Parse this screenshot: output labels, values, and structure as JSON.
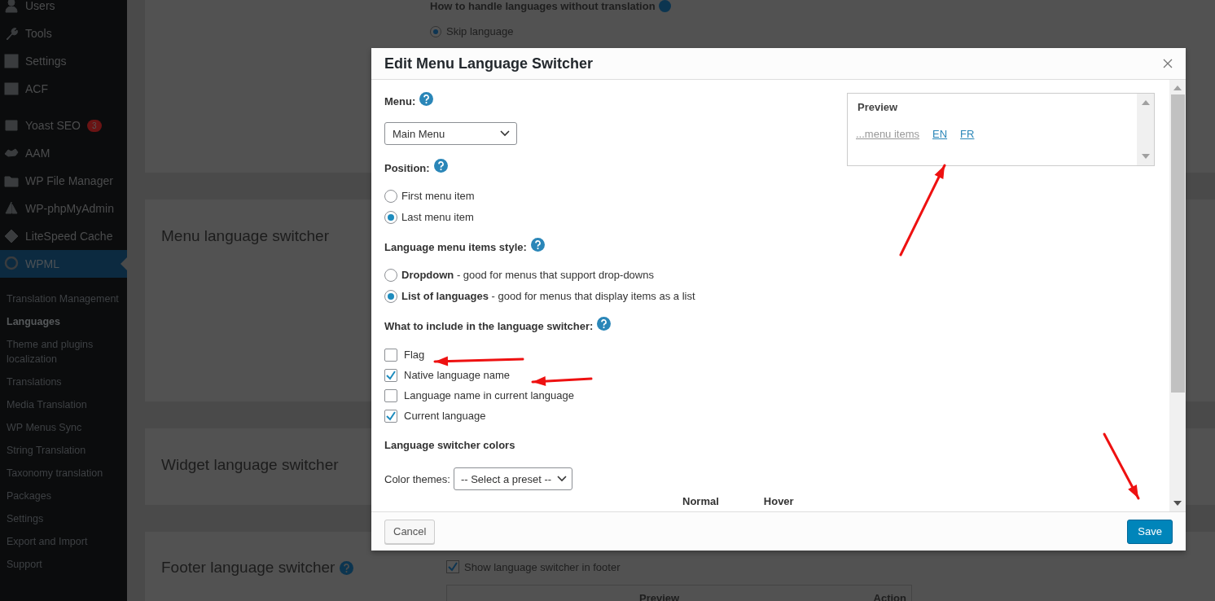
{
  "sidebar": {
    "items": [
      {
        "label": "Users",
        "selected": false
      },
      {
        "label": "Tools",
        "selected": false
      },
      {
        "label": "Settings",
        "selected": false
      },
      {
        "label": "ACF",
        "selected": false
      },
      {
        "label": "Yoast SEO",
        "badge": "3",
        "selected": false
      },
      {
        "label": "AAM",
        "selected": false
      },
      {
        "label": "WP File Manager",
        "selected": false
      },
      {
        "label": "WP-phpMyAdmin",
        "selected": false
      },
      {
        "label": "LiteSpeed Cache",
        "selected": false
      },
      {
        "label": "WPML",
        "selected": true
      }
    ],
    "submenu": [
      {
        "label": "Translation Management",
        "selected": false
      },
      {
        "label": "Languages",
        "selected": true
      },
      {
        "label": "Theme and plugins localization",
        "selected": false
      },
      {
        "label": "Translations",
        "selected": false
      },
      {
        "label": "Media Translation",
        "selected": false
      },
      {
        "label": "WP Menus Sync",
        "selected": false
      },
      {
        "label": "String Translation",
        "selected": false
      },
      {
        "label": "Taxonomy translation",
        "selected": false
      },
      {
        "label": "Packages",
        "selected": false
      },
      {
        "label": "Settings",
        "selected": false
      },
      {
        "label": "Export and Import",
        "selected": false
      },
      {
        "label": "Support",
        "selected": false
      }
    ]
  },
  "page": {
    "top_section": {
      "question": "How to handle languages without translation",
      "option": {
        "label": "Skip language",
        "selected": true
      }
    },
    "sections": [
      {
        "title": "Menu language switcher",
        "help": false
      },
      {
        "title": "Widget language switcher",
        "help": false
      },
      {
        "title": "Footer language switcher",
        "help": true,
        "checkbox": {
          "label": "Show language switcher in footer",
          "checked": true
        },
        "table_columns": [
          "Preview",
          "Action"
        ]
      }
    ]
  },
  "dialog": {
    "title": "Edit Menu Language Switcher",
    "menu": {
      "label": "Menu:",
      "value": "Main Menu"
    },
    "position": {
      "label": "Position:",
      "options": [
        {
          "label": "First menu item",
          "selected": false
        },
        {
          "label": "Last menu item",
          "selected": true
        }
      ]
    },
    "style": {
      "label": "Language menu items style:",
      "options": [
        {
          "label": "**Dropdown** - good for menus that support drop-downs",
          "selected": false
        },
        {
          "label": "**List of languages** - good for menus that display items as a list",
          "selected": true
        }
      ]
    },
    "include": {
      "label": "What to include in the language switcher:",
      "options": [
        {
          "label": "Flag",
          "checked": false
        },
        {
          "label": "Native language name",
          "checked": true
        },
        {
          "label": "Language name in current language",
          "checked": false
        },
        {
          "label": "Current language",
          "checked": true
        }
      ]
    },
    "colors": {
      "heading": "Language switcher colors",
      "theme_label": "Color themes:",
      "theme_value": "-- Select a preset --",
      "columns": [
        "Normal",
        "Hover"
      ]
    },
    "preview": {
      "title": "Preview",
      "links": [
        {
          "label": "...menu items",
          "kind": "placeholder"
        },
        {
          "label": "EN",
          "kind": "language"
        },
        {
          "label": "FR",
          "kind": "language"
        }
      ]
    },
    "buttons": {
      "cancel": "Cancel",
      "save": "Save"
    }
  }
}
